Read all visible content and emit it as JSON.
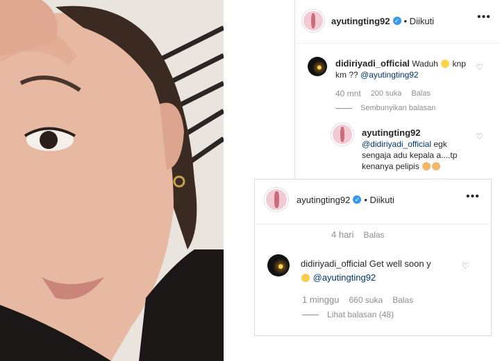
{
  "colors": {
    "verified": "#3897f0",
    "mention": "#00376b",
    "meta": "#8e8e8e"
  },
  "panel_top": {
    "header": {
      "username": "ayutingting92",
      "verified_icon": "verified-badge-icon",
      "follow_status": "• Diikuti",
      "more_icon": "more-options-icon"
    },
    "comment": {
      "username": "didiriyadi_official",
      "text_before_emoji": "Waduh",
      "emoji": "screaming-face-emoji",
      "text_after": "knp km ??",
      "mention": "@ayutingting92"
    },
    "comment_meta": {
      "time": "40 mnt",
      "likes": "200 suka",
      "reply": "Balas"
    },
    "hide_replies": "Sembunyikan balasan",
    "reply": {
      "username": "ayutingting92",
      "mention": "@didiriyadi_official",
      "text": "egk sengaja adu kepala a....tp kenanya pelipis",
      "emojis": [
        "folded-hands-emoji",
        "folded-hands-emoji"
      ]
    }
  },
  "panel_bottom": {
    "header": {
      "username": "ayutingting92",
      "verified_icon": "verified-badge-icon",
      "follow_status": "• Diikuti",
      "more_icon": "more-options-icon"
    },
    "prev_meta": {
      "time": "4 hari",
      "reply": "Balas"
    },
    "comment": {
      "username": "didiriyadi_official",
      "text": "Get well soon y",
      "emoji": "smiling-face-emoji",
      "mention": "@ayutingting92"
    },
    "comment_meta": {
      "time": "1 minggu",
      "likes": "660 suka",
      "reply": "Balas"
    },
    "view_replies": "Lihat balasan (48)"
  }
}
